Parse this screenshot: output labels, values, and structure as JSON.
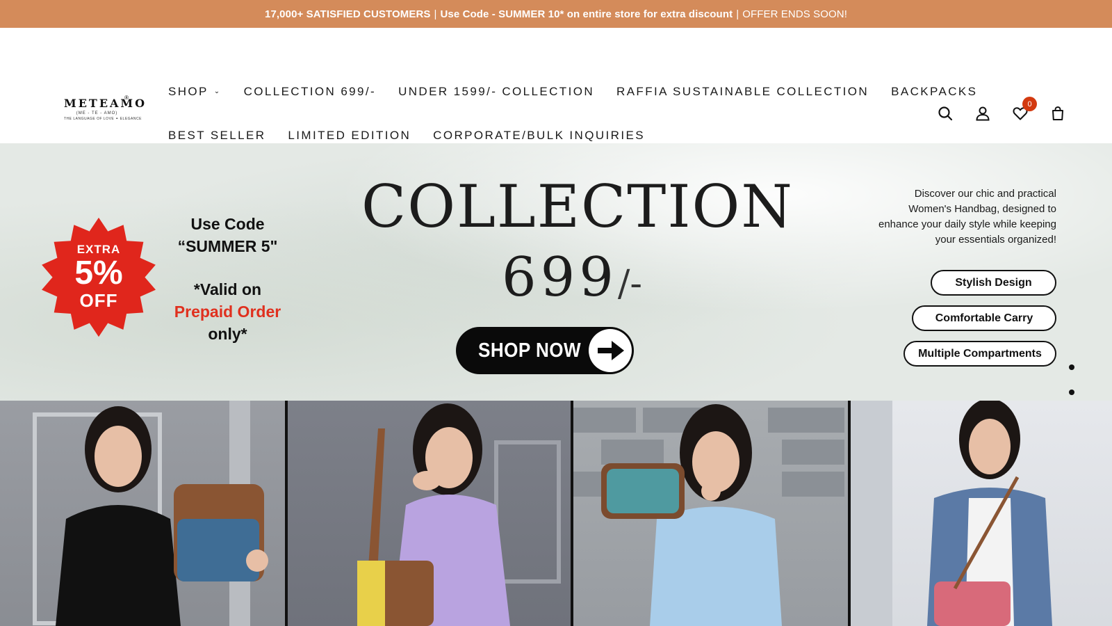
{
  "announcement": {
    "customers": "17,000+ SATISFIED CUSTOMERS",
    "sep1": "|",
    "offer": "Use Code - SUMMER 10* on entire store for extra discount",
    "sep2": "|",
    "ends": "OFFER ENDS SOON!"
  },
  "logo": {
    "word": "METEAMO",
    "reg": "®",
    "pronunciation": "(ME - TE - AMO)",
    "tagline": "THE LANGUAGE OF LOVE ⚭ ELEGANCE"
  },
  "nav": {
    "row1": [
      {
        "label": "SHOP",
        "has_dropdown": true,
        "chevron": "⌄"
      },
      {
        "label": "COLLECTION 699/-"
      },
      {
        "label": "UNDER 1599/- COLLECTION"
      },
      {
        "label": "RAFFIA SUSTAINABLE COLLECTION"
      },
      {
        "label": "BACKPACKS"
      }
    ],
    "row2": [
      {
        "label": "BEST SELLER"
      },
      {
        "label": "LIMITED EDITION"
      },
      {
        "label": "CORPORATE/BULK INQUIRIES"
      }
    ]
  },
  "header_icons": {
    "search": "search-icon",
    "account": "user-icon",
    "wishlist": "heart-icon",
    "wishlist_count": "0",
    "cart": "bag-icon",
    "badge_color": "#d33a10"
  },
  "hero": {
    "badge": {
      "line1": "EXTRA",
      "line2": "5%",
      "line3": "OFF",
      "color": "#e0261c"
    },
    "use_code": {
      "line1": "Use Code",
      "line2": "“SUMMER 5\"",
      "line3": "*Valid on",
      "line4": "Prepaid Order",
      "line5": "only*"
    },
    "title": "COLLECTION",
    "price": "699",
    "price_suffix": "/-",
    "cta": "SHOP NOW",
    "description": "Discover our chic and practical Women's Handbag, designed to enhance your daily style while keeping your essentials organized!",
    "features": [
      "Stylish Design",
      "Comfortable Carry",
      "Multiple Compartments"
    ],
    "slides": 4
  },
  "colors": {
    "announcement_bg": "#d48b5a",
    "accent_red": "#e0301e"
  }
}
